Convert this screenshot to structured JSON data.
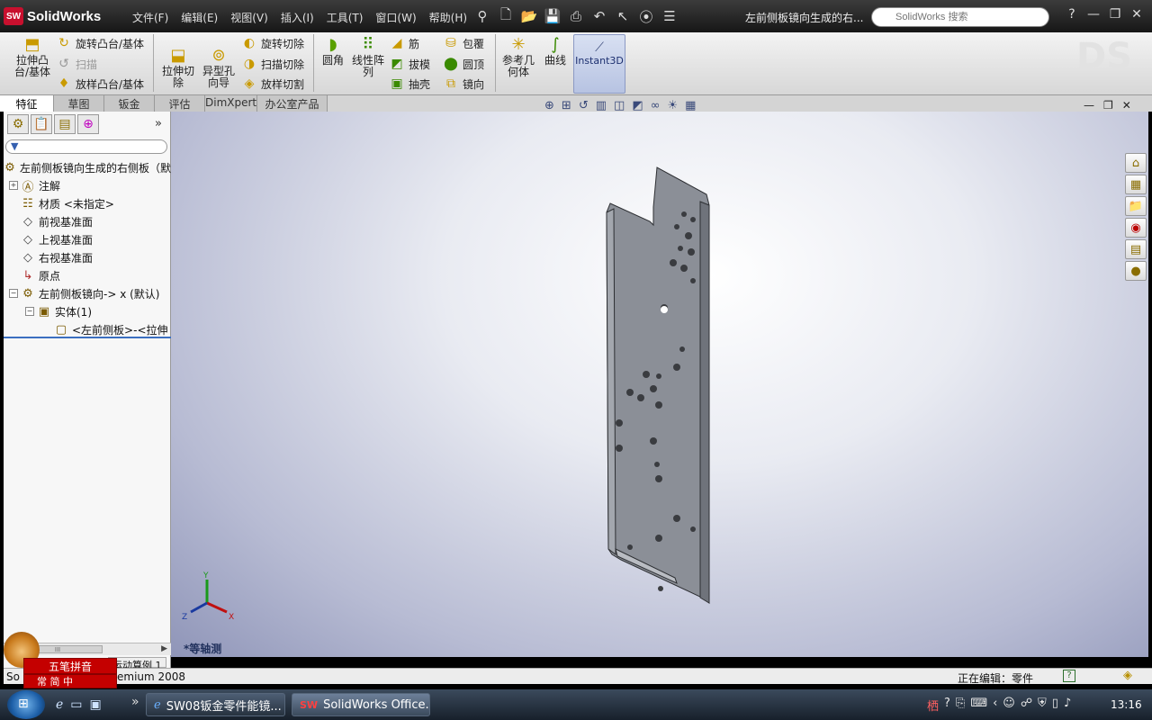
{
  "app": {
    "logo_text": "SolidWorks",
    "logo_badge": "SW"
  },
  "menu": [
    "文件(F)",
    "编辑(E)",
    "视图(V)",
    "插入(I)",
    "工具(T)",
    "窗口(W)",
    "帮助(H)"
  ],
  "doc_title": "左前侧板镜向生成的右...",
  "search": {
    "placeholder": "SolidWorks 搜索"
  },
  "commands": {
    "extrude_boss": "拉伸凸台/基体",
    "revolve_boss": "旋转凸台/基体",
    "sweep": "扫描",
    "loft_boss": "放样凸台/基体",
    "extrude_cut": "拉伸切除",
    "hole_wizard": "异型孔向导",
    "revolve_cut": "旋转切除",
    "sweep_cut": "扫描切除",
    "loft_cut": "放样切割",
    "fillet": "圆角",
    "linear_pattern": "线性阵列",
    "rib": "筋",
    "draft": "拔模",
    "shell": "抽壳",
    "wrap": "包覆",
    "dome": "圆顶",
    "mirror": "镜向",
    "ref_geometry": "参考几何体",
    "curves": "曲线",
    "instant3d": "Instant3D"
  },
  "tabs": [
    "特征",
    "草图",
    "钣金",
    "评估",
    "DimXpert",
    "办公室产品"
  ],
  "tree": {
    "root": "左前侧板镜向生成的右侧板（默",
    "annotations": "注解",
    "material": "材质 <未指定>",
    "front_plane": "前视基准面",
    "top_plane": "上视基准面",
    "right_plane": "右视基准面",
    "origin": "原点",
    "feature": "左前侧板镜向-> x (默认)",
    "solid_bodies": "实体(1)",
    "body": "<左前侧板>-<拉伸"
  },
  "viewport": {
    "view_label": "*等轴测",
    "triad": {
      "x": "X",
      "y": "Y",
      "z": "Z"
    }
  },
  "status": {
    "left_prefix": "So",
    "left_suffix": "emium 2008",
    "editing": "正在编辑：零件",
    "sheet_tab": "运动算例 1"
  },
  "ime": {
    "name": "五笔拼音",
    "mode": "常 简 中"
  },
  "taskbar": {
    "tasks": [
      "SW08钣金零件能镜...",
      "SolidWorks Office..."
    ],
    "clock": "13:16"
  }
}
